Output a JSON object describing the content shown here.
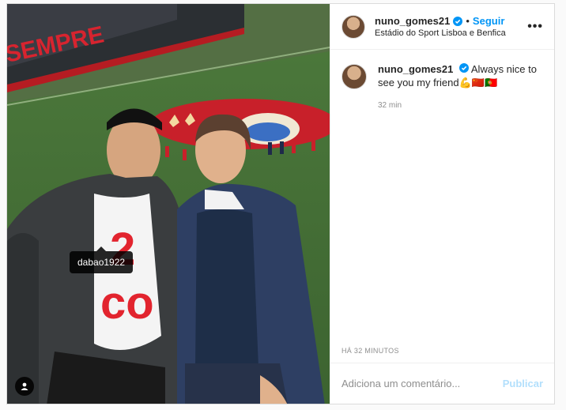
{
  "post": {
    "author": {
      "username": "nuno_gomes21",
      "verified": true,
      "follow_label": "Seguir",
      "location": "Estádio do Sport Lisboa e Benfica"
    },
    "more_icon": "more-options-icon",
    "photo": {
      "banner_text": "SEMPRE",
      "tag_label": "dabao1922",
      "tag_icon": "user-tag-icon"
    },
    "caption": {
      "username": "nuno_gomes21",
      "text": "Always nice to see you my friend",
      "emojis": "💪🇨🇳🇵🇹",
      "time": "32 min"
    },
    "posted_label": "HÁ 32 MINUTOS",
    "comment_box": {
      "placeholder": "Adiciona um comentário...",
      "publish_label": "Publicar"
    }
  },
  "colors": {
    "accent": "#0095f6",
    "publish_disabled": "#b2dffc",
    "benfica_red": "#e30613"
  }
}
